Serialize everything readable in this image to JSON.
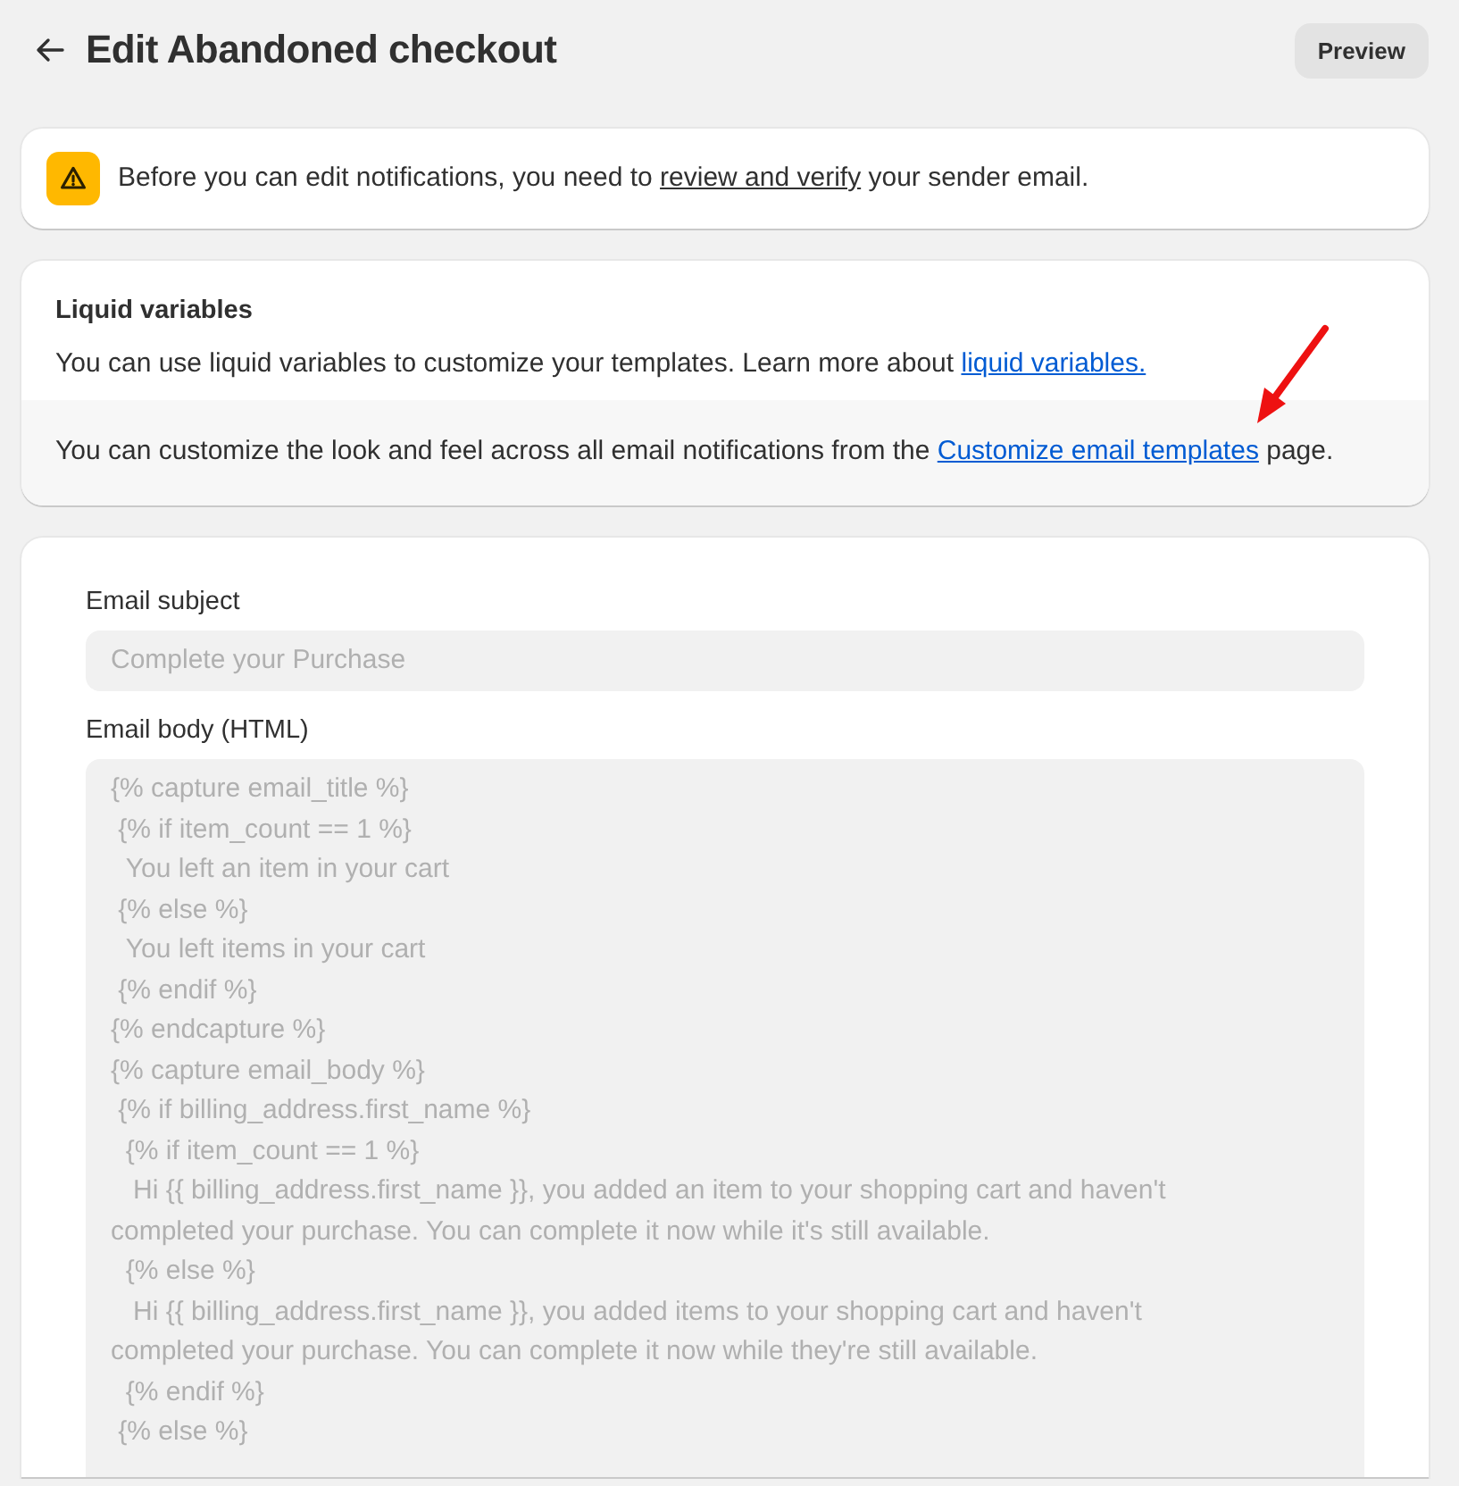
{
  "header": {
    "title": "Edit Abandoned checkout",
    "back": {
      "kind": "arrow"
    },
    "actions": [
      {
        "label": "Preview"
      }
    ]
  },
  "banner": {
    "parts": [
      {
        "kind": "text",
        "text": "Before you can edit notifications, you need to "
      },
      {
        "kind": "link",
        "text": "review and verify"
      },
      {
        "kind": "text",
        "text": " your sender email."
      }
    ]
  },
  "liquid": {
    "title": "Liquid variables",
    "sections": [
      {
        "parts": [
          {
            "kind": "text",
            "text": "You can use liquid variables to customize your templates. Learn more about "
          },
          {
            "kind": "link",
            "text": "liquid variables."
          }
        ]
      },
      {
        "parts": [
          {
            "kind": "text",
            "text": "You can customize the look and feel across all email notifications from the "
          },
          {
            "kind": "link",
            "text": "Customize email templates"
          },
          {
            "kind": "text",
            "text": " page."
          }
        ]
      }
    ]
  },
  "annotation": {
    "kind": "arrow"
  },
  "form": {
    "subject": {
      "label": "Email subject",
      "value": "Complete your Purchase",
      "disabled": true
    },
    "body": {
      "label": "Email body (HTML)",
      "disabled": true,
      "value": "{% capture email_title %}\n {% if item_count == 1 %}\n  You left an item in your cart\n {% else %}\n  You left items in your cart\n {% endif %}\n{% endcapture %}\n{% capture email_body %}\n {% if billing_address.first_name %}\n  {% if item_count == 1 %}\n   Hi {{ billing_address.first_name }}, you added an item to your shopping cart and haven't completed your purchase. You can complete it now while it's still available.\n  {% else %}\n   Hi {{ billing_address.first_name }}, you added items to your shopping cart and haven't completed your purchase. You can complete it now while they're still available.\n  {% endif %}\n {% else %}"
    }
  }
}
